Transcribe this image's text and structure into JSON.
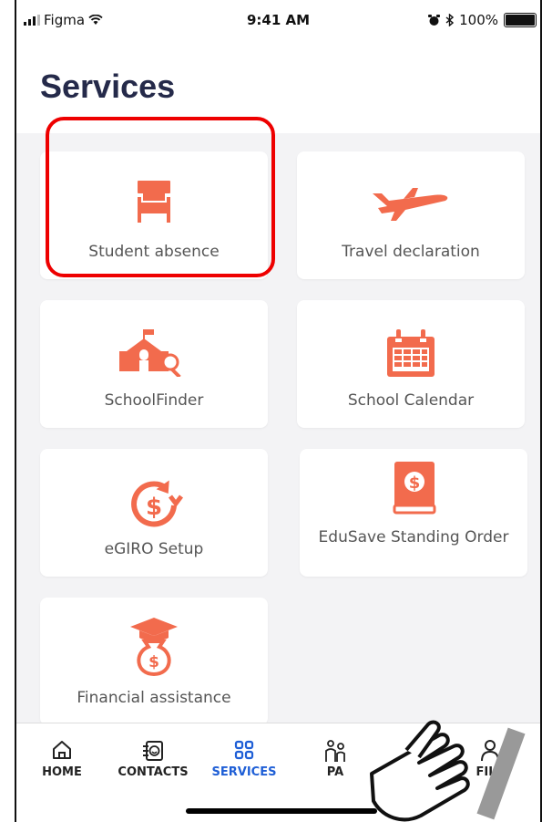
{
  "status_bar": {
    "carrier": "Figma",
    "time": "9:41 AM",
    "battery": "100%"
  },
  "header": {
    "title": "Services"
  },
  "services": [
    {
      "label": "Student absence",
      "icon": "chair-icon"
    },
    {
      "label": "Travel declaration",
      "icon": "airplane-icon"
    },
    {
      "label": "SchoolFinder",
      "icon": "school-search-icon"
    },
    {
      "label": "School Calendar",
      "icon": "calendar-icon"
    },
    {
      "label": "eGIRO Setup",
      "icon": "recurring-dollar-icon"
    },
    {
      "label": "EduSave Standing Order",
      "icon": "dollar-book-icon"
    },
    {
      "label": "Financial assistance",
      "icon": "graduation-money-bag-icon"
    }
  ],
  "tabbar": {
    "items": [
      {
        "label": "HOME",
        "icon": "home-icon"
      },
      {
        "label": "CONTACTS",
        "icon": "contacts-icon"
      },
      {
        "label": "SERVICES",
        "icon": "grid-icon"
      },
      {
        "label": "PA",
        "icon": "parent-child-icon"
      },
      {
        "label": "FILE",
        "icon": "profile-icon"
      }
    ],
    "active": "SERVICES"
  },
  "colors": {
    "accent": "#f26b4d",
    "tab_active": "#1f5fd6",
    "highlight": "#e00000",
    "title": "#252a4a"
  }
}
